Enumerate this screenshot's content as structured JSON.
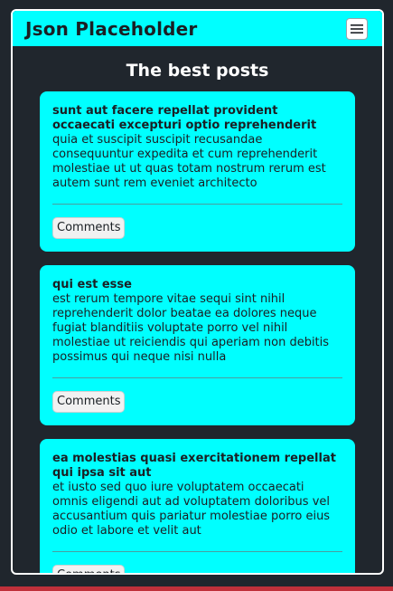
{
  "app": {
    "brand": "Json Placeholder",
    "menu_icon": "hamburger-menu-icon"
  },
  "main": {
    "heading": "The best posts"
  },
  "posts": [
    {
      "title": "sunt aut facere repellat provident occaecati excepturi optio reprehenderit",
      "body": "quia et suscipit suscipit recusandae consequuntur expedita et cum reprehenderit molestiae ut ut quas totam nostrum rerum est autem sunt rem eveniet architecto",
      "button_label": "Comments"
    },
    {
      "title": "qui est esse",
      "body": "est rerum tempore vitae sequi sint nihil reprehenderit dolor beatae ea dolores neque fugiat blanditiis voluptate porro vel nihil molestiae ut reiciendis qui aperiam non debitis possimus qui neque nisi nulla",
      "button_label": "Comments"
    },
    {
      "title": "ea molestias quasi exercitationem repellat qui ipsa sit aut",
      "body": "et iusto sed quo iure voluptatem occaecati omnis eligendi aut ad voluptatem doloribus vel accusantium quis pariatur molestiae porro eius odio et labore et velit aut",
      "button_label": "Comments"
    }
  ],
  "colors": {
    "accent": "#00ffff",
    "background": "#20262d",
    "text": "#1a1f24",
    "frame_border": "#ffffff"
  }
}
